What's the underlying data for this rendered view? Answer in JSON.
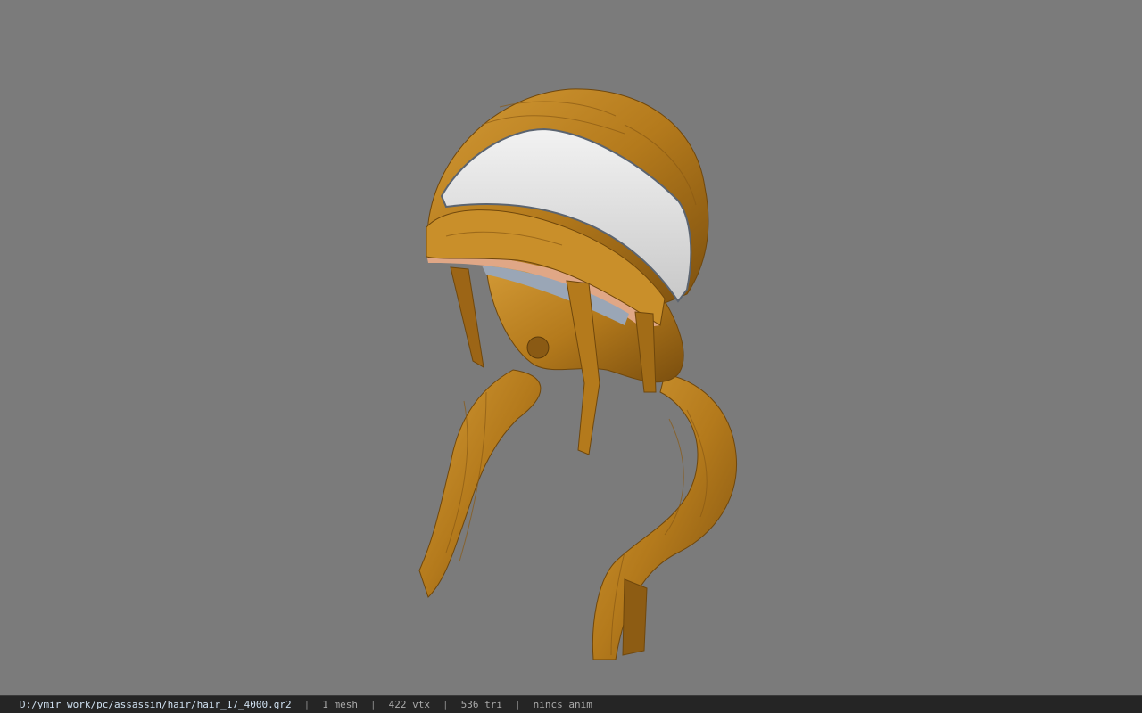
{
  "viewer": {
    "background_color": "#7b7b7b",
    "model": {
      "hair_color": "#b47a1c",
      "headband_color": "#e6e6e6"
    }
  },
  "statusbar": {
    "file_path": "D:/ymir work/pc/assassin/hair/hair_17_4000.gr2",
    "separator": "|",
    "mesh_count": "1 mesh",
    "vertex_count": "422 vtx",
    "triangle_count": "536 tri",
    "anim_status": "nincs anim"
  }
}
